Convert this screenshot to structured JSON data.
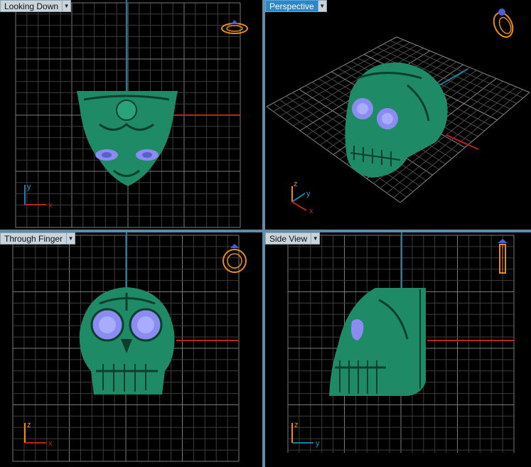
{
  "viewports": {
    "top_left": {
      "label": "Looking Down",
      "axes": [
        "y",
        "x"
      ],
      "active": false
    },
    "top_right": {
      "label": "Perspective",
      "axes": [
        "z",
        "y",
        "x"
      ],
      "active": true
    },
    "bottom_left": {
      "label": "Through Finger",
      "axes": [
        "z",
        "x"
      ],
      "active": false
    },
    "bottom_right": {
      "label": "Side View",
      "axes": [
        "z",
        "y"
      ],
      "active": false
    }
  },
  "icons": {
    "dropdown": "chevron-down-icon",
    "ring_orientation": "ring-icon"
  },
  "colors": {
    "grid": "#5a5a5a",
    "axis_red": "#c0201c",
    "axis_blue": "#1f7fa0",
    "model_green": "#1f8a66",
    "model_dark": "#0c3f2c",
    "eye_blue": "#8a8cf2",
    "ring_orange": "#e88a1e",
    "active_label": "#2f86c4"
  }
}
